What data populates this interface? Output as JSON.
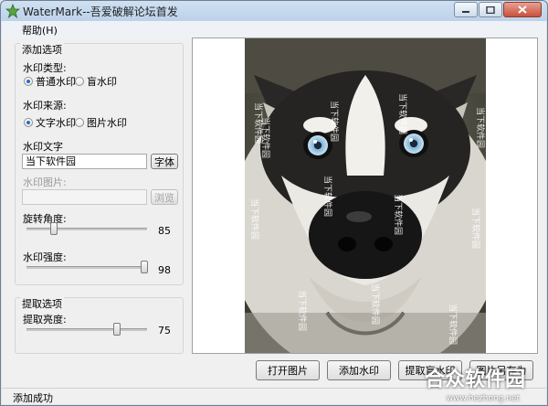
{
  "window": {
    "title": "WaterMark--吾爱破解论坛首发"
  },
  "menu": {
    "help": "帮助(H)"
  },
  "add_options": {
    "title": "添加选项",
    "type_label": "水印类型:",
    "type_normal": "普通水印",
    "type_blind": "盲水印",
    "source_label": "水印来源:",
    "source_text": "文字水印",
    "source_image": "图片水印",
    "text_label": "水印文字",
    "text_value": "当下软件园",
    "font_button": "字体",
    "image_label": "水印图片:",
    "image_value": "",
    "browse_button": "浏览",
    "rotation_label": "旋转角度:",
    "rotation_value": "85",
    "rotation_fraction": 0.23,
    "strength_label": "水印强度:",
    "strength_value": "98",
    "strength_fraction": 0.98
  },
  "extract_options": {
    "title": "提取选项",
    "brightness_label": "提取亮度:",
    "brightness_value": "75",
    "brightness_fraction": 0.75
  },
  "preview": {
    "watermark_text": "当下软件园"
  },
  "buttons": {
    "open_image": "打开图片",
    "add_watermark": "添加水印",
    "extract_blind": "提取盲水印",
    "save_image": "图片另存为"
  },
  "status": {
    "text": "添加成功"
  },
  "overlay": {
    "site_logo": "合众软件园",
    "site_url": "www.hezhong.net"
  }
}
